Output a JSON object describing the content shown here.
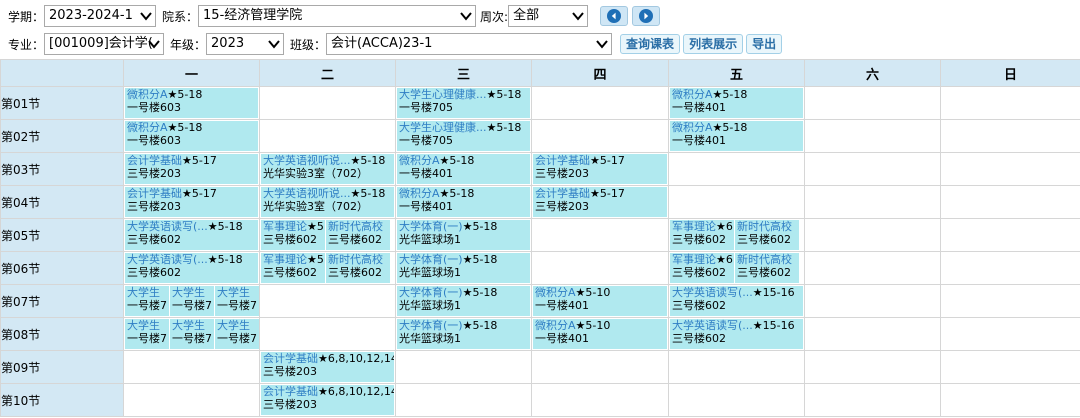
{
  "filters": {
    "term_label": "学期：",
    "term_value": "2023-2024-1",
    "dept_label": "院系：",
    "dept_value": "15-经济管理学院",
    "week_label": "周次:",
    "week_value": "全部",
    "major_label": "专业：",
    "major_value": "[001009]会计学(",
    "grade_label": "年级：",
    "grade_value": "2023",
    "class_label": "班级：",
    "class_value": "会计(ACCA)23-1",
    "query_button": "查询课表",
    "list_button": "列表展示",
    "export_button": "导出"
  },
  "colors": {
    "header_bg": "#d3e8f4",
    "course_bg": "#b0e9ef",
    "link": "#2f7ec4"
  },
  "days": [
    "一",
    "二",
    "三",
    "四",
    "五",
    "六",
    "日"
  ],
  "periods": [
    "第01节",
    "第02节",
    "第03节",
    "第04节",
    "第05节",
    "第06节",
    "第07节",
    "第08节",
    "第09节",
    "第10节"
  ],
  "cells": {
    "p1": {
      "mon": {
        "name": "微积分A",
        "weeks": "★5-18",
        "room": "一号楼603"
      },
      "wed": {
        "name": "大学生心理健康...",
        "weeks": "★5-18",
        "room": "一号楼705"
      },
      "fri": {
        "name": "微积分A",
        "weeks": "★5-18",
        "room": "一号楼401"
      }
    },
    "p2": {
      "mon": {
        "name": "微积分A",
        "weeks": "★5-18",
        "room": "一号楼603"
      },
      "wed": {
        "name": "大学生心理健康...",
        "weeks": "★5-18",
        "room": "一号楼705"
      },
      "fri": {
        "name": "微积分A",
        "weeks": "★5-18",
        "room": "一号楼401"
      }
    },
    "p3": {
      "mon": {
        "name": "会计学基础",
        "weeks": "★5-17",
        "room": "三号楼203"
      },
      "tue": {
        "name": "大学英语视听说...",
        "weeks": "★5-18",
        "room": "光华实验3室（702）"
      },
      "wed": {
        "name": "微积分A",
        "weeks": "★5-18",
        "room": "一号楼401"
      },
      "thu": {
        "name": "会计学基础",
        "weeks": "★5-17",
        "room": "三号楼203"
      }
    },
    "p4": {
      "mon": {
        "name": "会计学基础",
        "weeks": "★5-17",
        "room": "三号楼203"
      },
      "tue": {
        "name": "大学英语视听说...",
        "weeks": "★5-18",
        "room": "光华实验3室（702）"
      },
      "wed": {
        "name": "微积分A",
        "weeks": "★5-18",
        "room": "一号楼401"
      },
      "thu": {
        "name": "会计学基础",
        "weeks": "★5-17",
        "room": "三号楼203"
      }
    },
    "p5": {
      "mon": {
        "name": "大学英语读写(...",
        "weeks": "★5-18",
        "room": "三号楼602"
      },
      "tue_a": {
        "name": "军事理论",
        "weeks": "★5",
        "room": "三号楼602"
      },
      "tue_b": {
        "name": "新时代高校",
        "weeks": "",
        "room": "三号楼602"
      },
      "wed": {
        "name": "大学体育(一)",
        "weeks": "★5-18",
        "room": "光华篮球场1"
      },
      "fri_a": {
        "name": "军事理论",
        "weeks": "★6",
        "room": "三号楼602"
      },
      "fri_b": {
        "name": "新时代高校",
        "weeks": "",
        "room": "三号楼602"
      }
    },
    "p6": {
      "mon": {
        "name": "大学英语读写(...",
        "weeks": "★5-18",
        "room": "三号楼602"
      },
      "tue_a": {
        "name": "军事理论",
        "weeks": "★5",
        "room": "三号楼602"
      },
      "tue_b": {
        "name": "新时代高校",
        "weeks": "",
        "room": "三号楼602"
      },
      "wed": {
        "name": "大学体育(一)",
        "weeks": "★5-18",
        "room": "光华篮球场1"
      },
      "fri_a": {
        "name": "军事理论",
        "weeks": "★6",
        "room": "三号楼602"
      },
      "fri_b": {
        "name": "新时代高校",
        "weeks": "",
        "room": "三号楼602"
      }
    },
    "p7": {
      "mon_a": {
        "name": "大学生",
        "weeks": "",
        "room": "一号楼7"
      },
      "mon_b": {
        "name": "大学生",
        "weeks": "",
        "room": "一号楼7"
      },
      "mon_c": {
        "name": "大学生",
        "weeks": "",
        "room": "一号楼7"
      },
      "wed": {
        "name": "大学体育(一)",
        "weeks": "★5-18",
        "room": "光华篮球场1"
      },
      "thu": {
        "name": "微积分A",
        "weeks": "★5-10",
        "room": "一号楼401"
      },
      "fri": {
        "name": "大学英语读写(...",
        "weeks": "★15-16",
        "room": "三号楼602"
      }
    },
    "p8": {
      "mon_a": {
        "name": "大学生",
        "weeks": "",
        "room": "一号楼7"
      },
      "mon_b": {
        "name": "大学生",
        "weeks": "",
        "room": "一号楼7"
      },
      "mon_c": {
        "name": "大学生",
        "weeks": "",
        "room": "一号楼7"
      },
      "wed": {
        "name": "大学体育(一)",
        "weeks": "★5-18",
        "room": "光华篮球场1"
      },
      "thu": {
        "name": "微积分A",
        "weeks": "★5-10",
        "room": "一号楼401"
      },
      "fri": {
        "name": "大学英语读写(...",
        "weeks": "★15-16",
        "room": "三号楼602"
      }
    },
    "p9": {
      "tue": {
        "name": "会计学基础",
        "weeks": "★6,8,10,12,14",
        "room": "三号楼203"
      }
    },
    "p10": {
      "tue": {
        "name": "会计学基础",
        "weeks": "★6,8,10,12,14",
        "room": "三号楼203"
      }
    }
  }
}
